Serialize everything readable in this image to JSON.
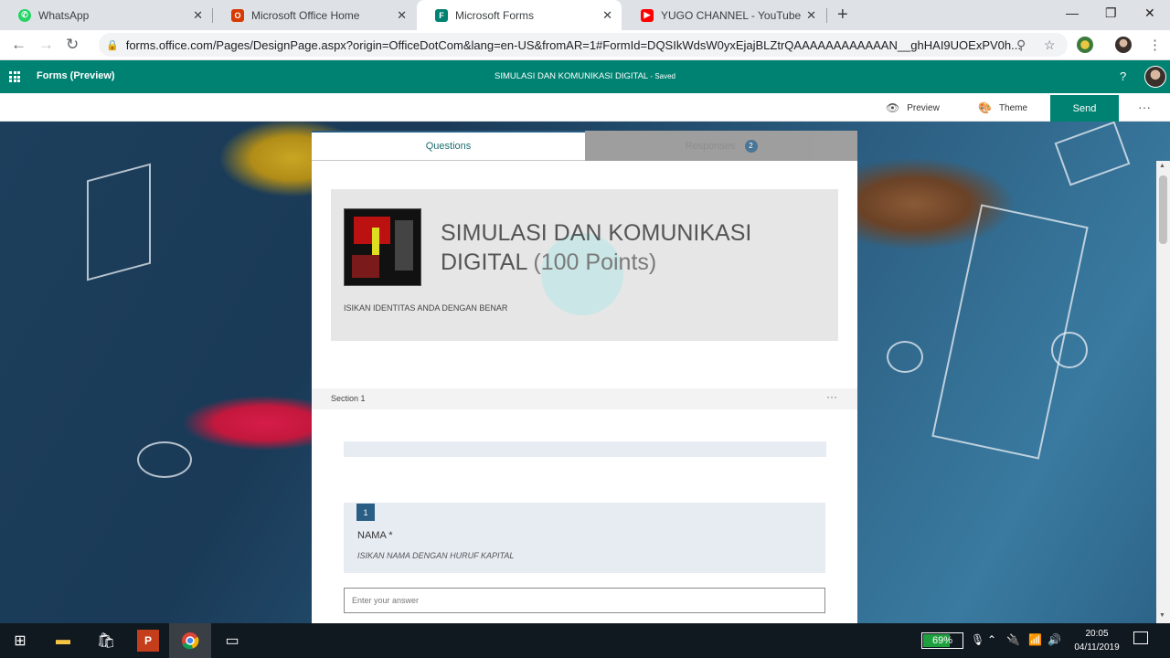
{
  "browser": {
    "tabs": [
      {
        "label": "WhatsApp",
        "icon": "whatsapp-icon",
        "color": "#25D366"
      },
      {
        "label": "Microsoft Office Home",
        "icon": "office-icon",
        "color": "#D83B01"
      },
      {
        "label": "Microsoft Forms",
        "icon": "forms-icon",
        "color": "#008272"
      },
      {
        "label": "YUGO CHANNEL - YouTube",
        "icon": "youtube-icon",
        "color": "#FF0000"
      }
    ],
    "new_tab": "+",
    "url": "forms.office.com/Pages/DesignPage.aspx?origin=OfficeDotCom&lang=en-US&fromAR=1#FormId=DQSIkWdsW0yxEjajBLZtrQAAAAAAAAAAAAN__ghHAI9UOExPV0h..."
  },
  "forms_bar": {
    "app_name": "Forms (Preview)",
    "doc_title": "SIMULASI DAN KOMUNIKASI DIGITAL",
    "doc_status": " - Saved",
    "help": "?"
  },
  "command_bar": {
    "preview_label": "Preview",
    "theme_label": "Theme",
    "send_label": "Send",
    "more": "···"
  },
  "tabs": {
    "questions_label": "Questions",
    "responses_label": "Responses",
    "responses_count": "2"
  },
  "form": {
    "title_main": "SIMULASI DAN KOMUNIKASI DIGITAL",
    "title_points": "(100 Points)",
    "description": "ISIKAN IDENTITAS ANDA DENGAN BENAR",
    "section_label": "Section 1",
    "section_menu": "···",
    "questions": [
      {
        "number": "1",
        "title": "NAMA *",
        "subtitle": "ISIKAN NAMA DENGAN HURUF KAPITAL",
        "placeholder": "Enter your answer"
      }
    ]
  },
  "taskbar": {
    "battery": "69%",
    "battery_level": 0.69,
    "time": "20:05",
    "date": "04/11/2019"
  },
  "colors": {
    "forms_green": "#008272",
    "accent_blue": "#2b5e84"
  }
}
